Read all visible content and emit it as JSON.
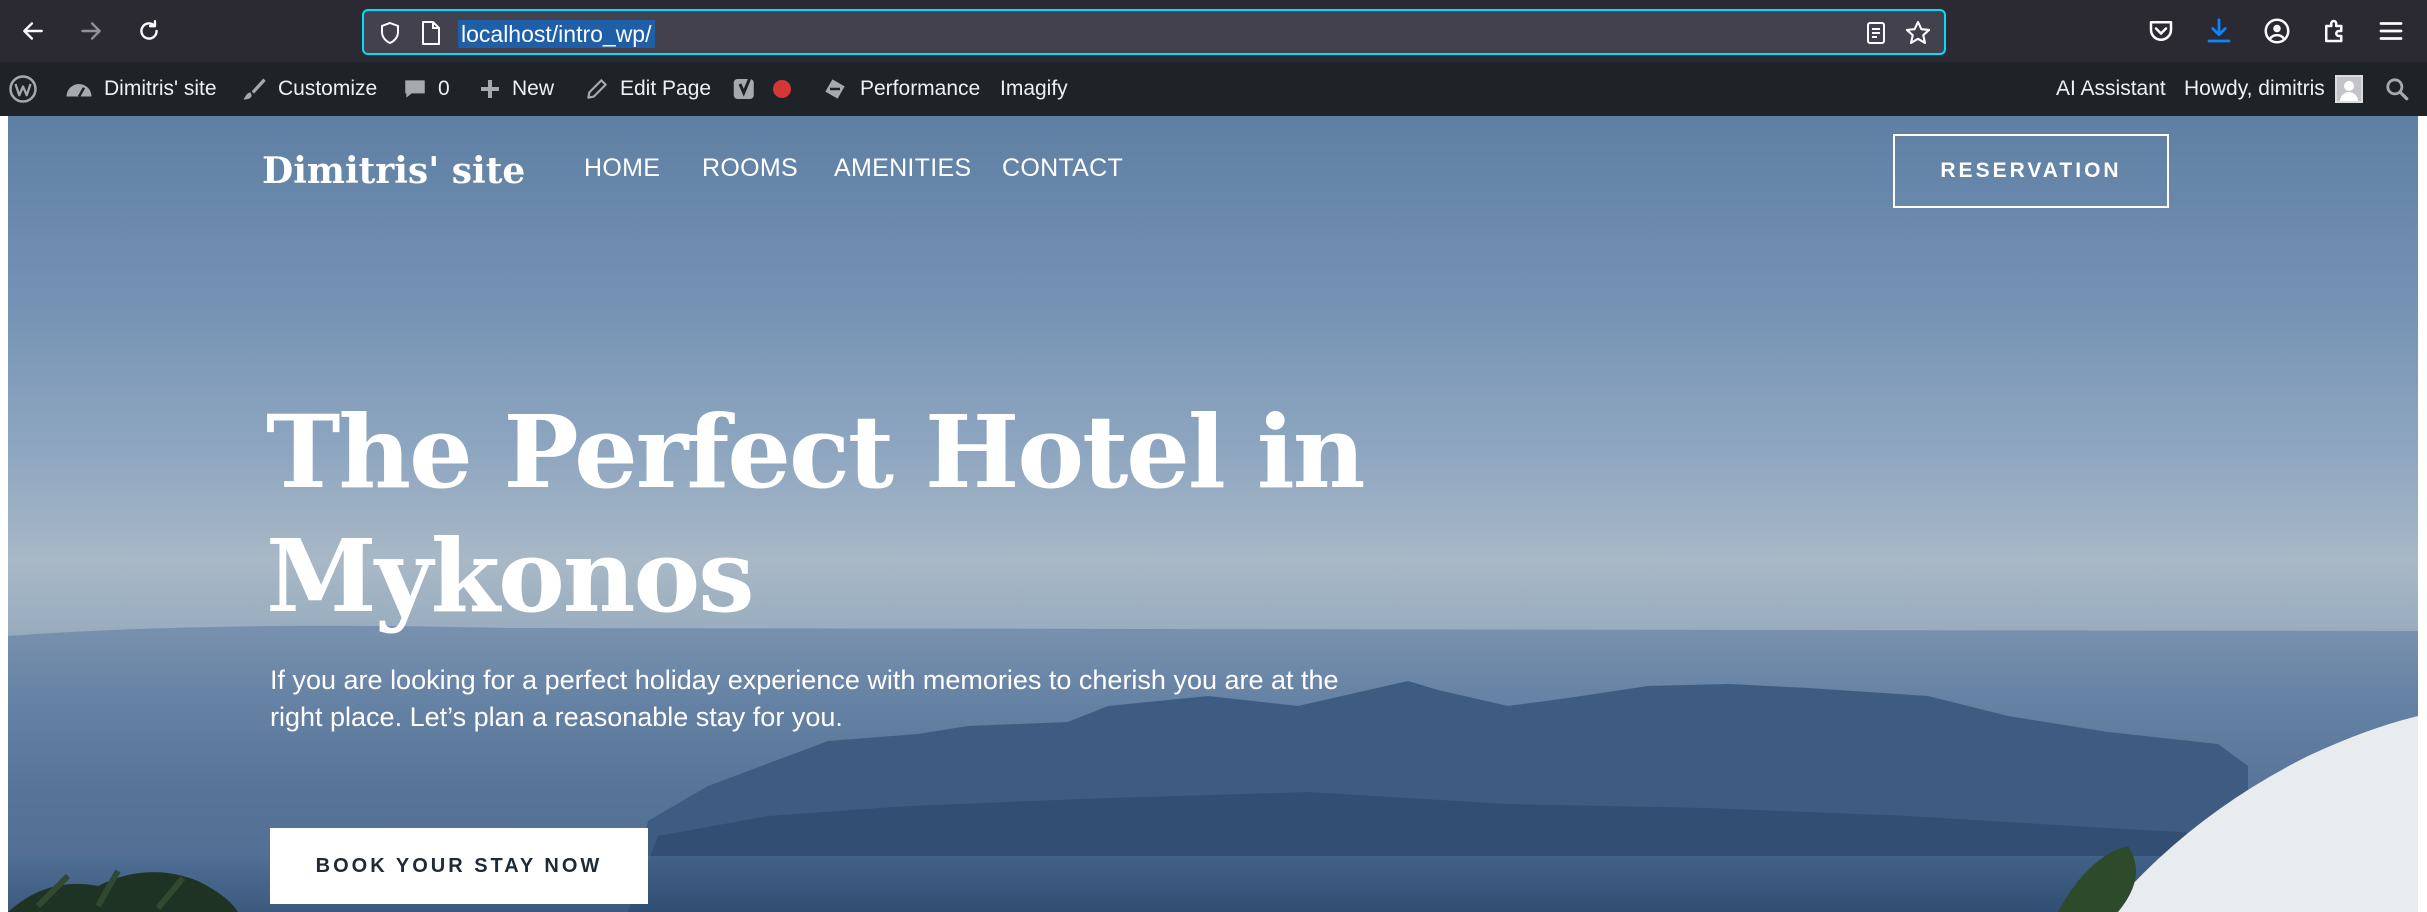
{
  "browser": {
    "url": "localhost/intro_wp/",
    "icons": [
      "back-arrow-icon",
      "forward-arrow-icon",
      "reload-icon",
      "shield-icon",
      "page-icon",
      "reader-view-icon",
      "bookmark-star-icon",
      "pocket-icon",
      "download-icon",
      "account-icon",
      "extensions-icon",
      "menu-icon"
    ]
  },
  "admin_bar": {
    "site_name": "Dimitris' site",
    "customize": "Customize",
    "comments_count": "0",
    "new": "New",
    "edit_page": "Edit Page",
    "performance": "Performance",
    "imagify": "Imagify",
    "ai_assistant": "AI Assistant",
    "howdy": "Howdy, dimitris"
  },
  "site": {
    "title": "Dimitris' site",
    "nav": [
      "HOME",
      "ROOMS",
      "AMENITIES",
      "CONTACT"
    ],
    "reservation": "RESERVATION"
  },
  "hero": {
    "title_line1": "The Perfect Hotel in",
    "title_line2": "Mykonos",
    "text_line1": "If you are looking for a perfect holiday experience with memories to cherish you are at the",
    "text_line2": "right place. Let’s plan a reasonable stay for you.",
    "cta": "BOOK YOUR STAY NOW"
  },
  "colors": {
    "browser_bg": "#2b2a33",
    "url_focus": "#00ddff",
    "admin_bar_bg": "#1d2327",
    "download_accent": "#0a84ff",
    "record_dot": "#d63638"
  }
}
